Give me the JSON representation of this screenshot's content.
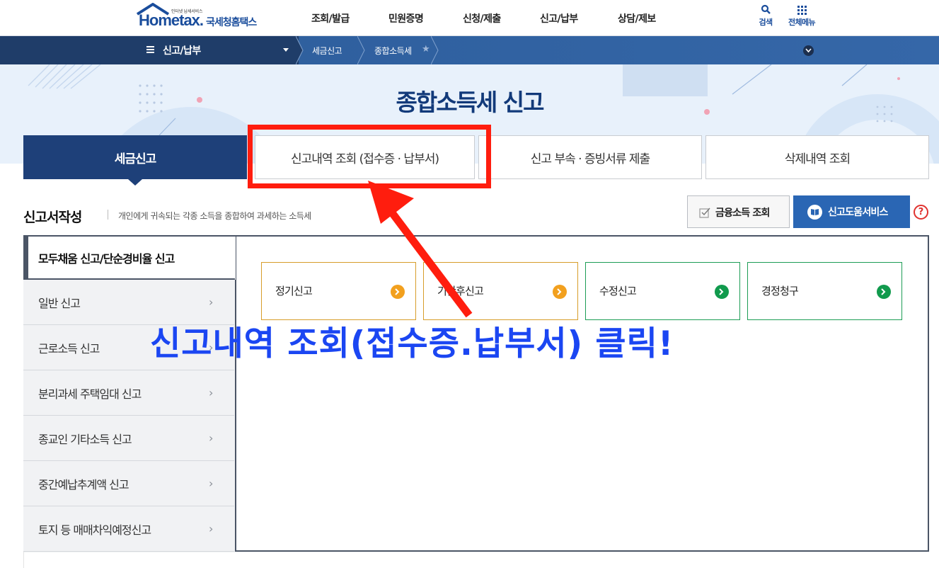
{
  "header": {
    "logo_tagline": "인터넷 납세서비스",
    "logo_brand": "Hometax.",
    "logo_brand_ko": "국세청홈택스",
    "nav": [
      "조회/발급",
      "민원증명",
      "신청/제출",
      "신고/납부",
      "상담/제보"
    ],
    "search_label": "검색",
    "all_menu_label": "전체메뉴"
  },
  "breadcrumb": {
    "menu_label": "신고/납부",
    "items": [
      "세금신고",
      "종합소득세"
    ]
  },
  "hero": {
    "title": "종합소득세 신고"
  },
  "tabs": [
    {
      "label": "세금신고",
      "active": true
    },
    {
      "label": "신고내역 조회 (접수증 · 납부서)",
      "active": false
    },
    {
      "label": "신고 부속 · 증빙서류 제출",
      "active": false
    },
    {
      "label": "삭제내역 조회",
      "active": false
    }
  ],
  "section": {
    "title": "신고서작성",
    "description": "개인에게 귀속되는 각종 소득을 종합하여 과세하는 소득세",
    "financial_income_button": "금융소득 조회",
    "help_service_button": "신고도움서비스",
    "help_icon": "?"
  },
  "sidebar": {
    "active": "모두채움 신고/단순경비율 신고",
    "items": [
      "일반 신고",
      "근로소득 신고",
      "분리과세 주택임대 신고",
      "종교인 기타소득 신고",
      "중간예납추계액 신고",
      "토지 등 매매차익예정신고"
    ],
    "chevron": "›"
  },
  "cards": [
    {
      "label": "정기신고",
      "color": "#f2a01e"
    },
    {
      "label": "기한후신고",
      "color": "#f2a01e"
    },
    {
      "label": "수정신고",
      "color": "#119a4d"
    },
    {
      "label": "경정청구",
      "color": "#119a4d"
    }
  ],
  "annotation": {
    "text": "신고내역 조회(접수증.납부서) 클릭!",
    "box_color": "#ff1d0e",
    "text_color": "#1b46f2"
  },
  "colors": {
    "navy": "#1e4079",
    "brand_blue": "#1a4d9c",
    "hero_bg": "#e8f1fb"
  }
}
